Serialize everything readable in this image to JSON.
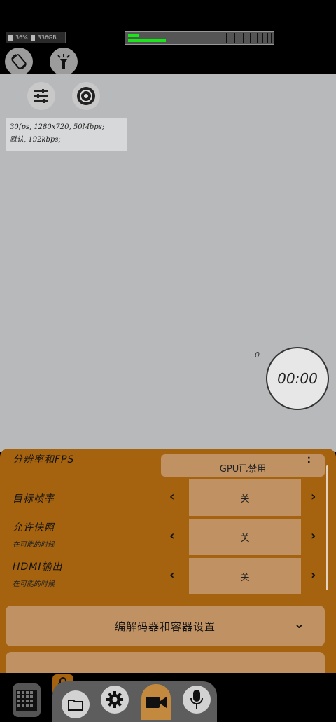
{
  "status": {
    "storage_pct": "36%",
    "storage_size": "336GB"
  },
  "camera_info": {
    "line1": "30fps, 1280x720, 50Mbps;",
    "line2": "默认, 192kbps;"
  },
  "counter": "0",
  "record_timer": "00:00",
  "panel": {
    "gpu_status": "GPU已禁用",
    "rows": [
      {
        "title": "分辨率和FPS"
      },
      {
        "title": "目标帧率",
        "sub": "",
        "value": "关"
      },
      {
        "title": "允许快照",
        "sub": "在可能的时候",
        "value": "关"
      },
      {
        "title": "HDMI输出",
        "sub": "在可能的时候",
        "value": "关"
      }
    ],
    "codec_title": "编解码器和容器设置"
  },
  "icons": [
    "rotate-icon",
    "flashlight-icon",
    "sliders-icon",
    "lens-icon",
    "grid-icon",
    "lock-icon",
    "folder-icon",
    "gear-icon",
    "video-icon",
    "microphone-icon"
  ],
  "colors": {
    "panel": "#a5630f",
    "card": "#c09162",
    "meter": "#17e617",
    "viewfinder": "#b7b9bb"
  }
}
